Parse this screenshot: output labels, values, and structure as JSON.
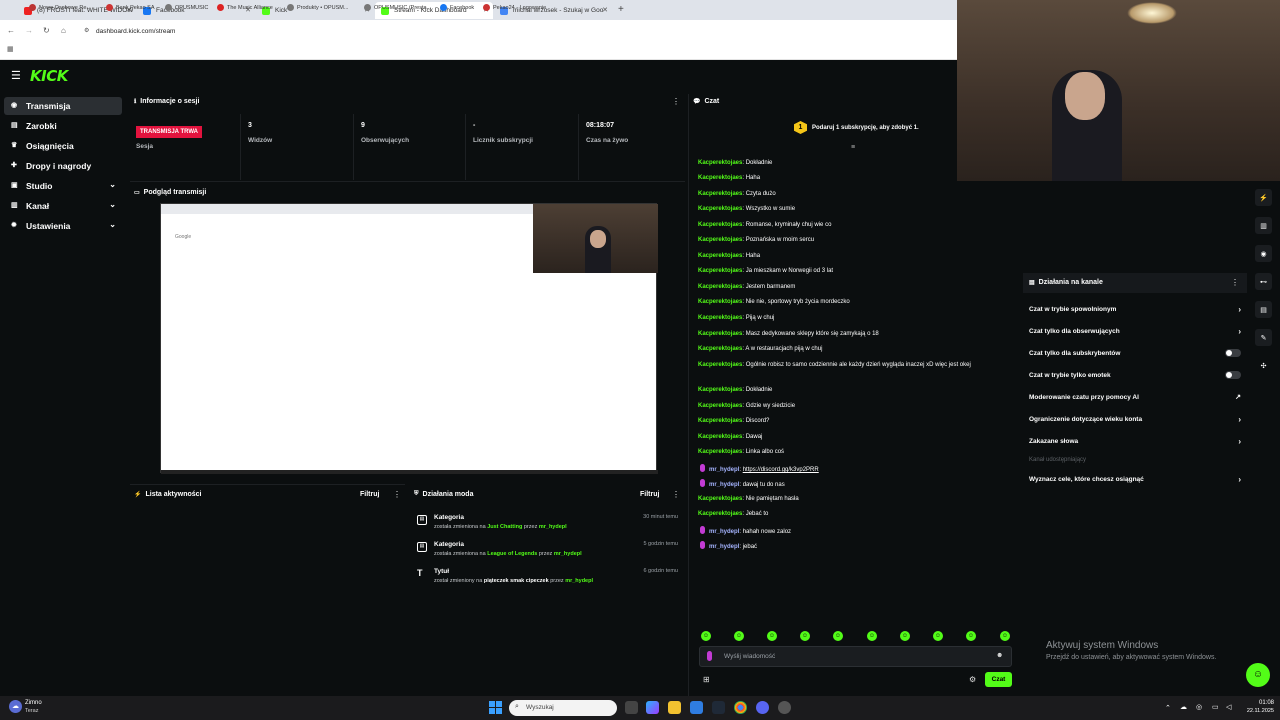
{
  "browser": {
    "tabs": [
      {
        "label": "(8) FROSTI feat. WHITE WIDOW",
        "fav": "#e22"
      },
      {
        "label": "Facebook",
        "fav": "#1877f2"
      },
      {
        "label": "Kick",
        "fav": "#53fc18"
      },
      {
        "label": "Stream - Kick Dashboard",
        "fav": "#53fc18"
      },
      {
        "label": "michal wrzosek - Szukaj w Goo",
        "fav": "#4285f4"
      }
    ],
    "new_tab": "+",
    "url": "dashboard.kick.com/stream",
    "bookmarks": [
      "Nowe Osobowe Re...",
      "Bank Pekao SA",
      "OPUSMUSIC",
      "The Music Alliance",
      "Produkty • OPUSM...",
      "OPUSMUSIC (Presta...",
      "Facebook",
      "Pekao24 - Logowanie"
    ]
  },
  "kick": {
    "logo": "KICK",
    "sidebar": [
      {
        "label": "Transmisja",
        "icon": "broadcast-icon",
        "active": true
      },
      {
        "label": "Zarobki",
        "icon": "wallet-icon"
      },
      {
        "label": "Osiągnięcia",
        "icon": "trophy-icon"
      },
      {
        "label": "Dropy i nagrody",
        "icon": "gift-icon"
      },
      {
        "label": "Studio",
        "icon": "studio-icon",
        "chevron": true
      },
      {
        "label": "Kanał",
        "icon": "channel-icon",
        "chevron": true
      },
      {
        "label": "Ustawienia",
        "icon": "gear-icon",
        "chevron": true
      }
    ]
  },
  "session": {
    "title": "Informacje o sesji",
    "badge": "TRANSMISJA TRWA",
    "badge_label": "Sesja",
    "stats": [
      {
        "value": "3",
        "label": "Widzów"
      },
      {
        "value": "9",
        "label": "Obserwujących"
      },
      {
        "value": "-",
        "label": "Licznik subskrypcji"
      },
      {
        "value": "08:18:07",
        "label": "Czas na żywo"
      }
    ]
  },
  "preview": {
    "title": "Podgląd transmisji"
  },
  "activity": {
    "title": "Lista aktywności",
    "filter": "Filtruj"
  },
  "modactions": {
    "title": "Działania moda",
    "filter": "Filtruj",
    "items": [
      {
        "title": "Kategoria",
        "pre": "została zmieniona na",
        "target": "Just Chatting",
        "mid": "przez",
        "user": "mr_hydepl",
        "time": "30 minut temu"
      },
      {
        "title": "Kategoria",
        "pre": "została zmieniona na",
        "target": "League of Legends",
        "mid": "przez",
        "user": "mr_hydepl",
        "time": "5 godzin temu"
      },
      {
        "title": "Tytuł",
        "pre": "został zmieniony na",
        "target": "piąteczek smak cipeczek",
        "mid": "przez",
        "user": "mr_hydepl",
        "time": "6 godzin temu"
      }
    ]
  },
  "chat": {
    "title": "Czat",
    "promo": "Podaruj 1 subskrypcję, aby zdobyć 1.",
    "promo_badge": "1",
    "input_placeholder": "Wyślij wiadomość",
    "send": "Czat",
    "messages": [
      {
        "user": "Kacperektojaes",
        "text": "Dokładnie"
      },
      {
        "user": "Kacperektojaes",
        "text": "Haha"
      },
      {
        "user": "Kacperektojaes",
        "text": "Czyta dużo"
      },
      {
        "user": "Kacperektojaes",
        "text": "Wszystko w sumie"
      },
      {
        "user": "Kacperektojaes",
        "text": "Romanse, kryminały chuj wie co"
      },
      {
        "user": "Kacperektojaes",
        "text": "Poznańska w moim sercu"
      },
      {
        "user": "Kacperektojaes",
        "text": "Haha"
      },
      {
        "user": "Kacperektojaes",
        "text": "Ja mieszkam w Norwegii od 3 lat"
      },
      {
        "user": "Kacperektojaes",
        "text": "Jestem barmanem"
      },
      {
        "user": "Kacperektojaes",
        "text": "Nie nie, sportowy tryb życia mordeczko"
      },
      {
        "user": "Kacperektojaes",
        "text": "Piją w chuj"
      },
      {
        "user": "Kacperektojaes",
        "text": "Masz dedykowane sklepy które się zamykają o 18"
      },
      {
        "user": "Kacperektojaes",
        "text": "A w restauracjach piją w chuj"
      },
      {
        "user": "Kacperektojaes",
        "text": "Ogólnie robisz to samo codziennie ale każdy dzień wygląda inaczej xD więc jest okej"
      },
      {
        "user": "Kacperektojaes",
        "text": "Dokładnie"
      },
      {
        "user": "Kacperektojaes",
        "text": "Gdzie wy siedzicie"
      },
      {
        "user": "Kacperektojaes",
        "text": "Discord?"
      },
      {
        "user": "Kacperektojaes",
        "text": "Dawaj"
      },
      {
        "user": "Kacperektojaes",
        "text": "Linka albo coś"
      },
      {
        "user": "mr_hydepl",
        "text": "https://discord.gg/k3vp2PRR",
        "mod": true,
        "link": true
      },
      {
        "user": "mr_hydepl",
        "text": "dawaj tu do nas",
        "mod": true
      },
      {
        "user": "Kacperektojaes",
        "text": "Nie pamiętam hasła"
      },
      {
        "user": "Kacperektojaes",
        "text": "Jebać to"
      },
      {
        "user": "mr_hydepl",
        "text": "hahah nowe zaloz",
        "mod": true
      },
      {
        "user": "mr_hydepl",
        "text": "jebać",
        "mod": true
      }
    ]
  },
  "channel_actions": {
    "title": "Działania na kanale",
    "items": [
      {
        "label": "Czat w trybie spowolnionym",
        "kind": "arrow"
      },
      {
        "label": "Czat tylko dla obserwujących",
        "kind": "arrow"
      },
      {
        "label": "Czat tylko dla subskrybentów",
        "kind": "toggle"
      },
      {
        "label": "Czat w trybie tylko emotek",
        "kind": "toggle"
      },
      {
        "label": "Moderowanie czatu przy pomocy AI",
        "kind": "ext"
      },
      {
        "label": "Ograniczenie dotyczące wieku konta",
        "kind": "arrow"
      },
      {
        "label": "Zakazane słowa",
        "kind": "arrow"
      }
    ],
    "shared": "Kanał udostępniający",
    "goal": "Wyznacz cele, które chcesz osiągnąć"
  },
  "windows": {
    "activate_title": "Aktywuj system Windows",
    "activate_sub": "Przejdź do ustawień, aby aktywować system Windows.",
    "weather": "Zimno",
    "weather_sub": "Teraz",
    "search": "Wyszukaj",
    "time": "01:08",
    "date": "22.11.2025"
  }
}
